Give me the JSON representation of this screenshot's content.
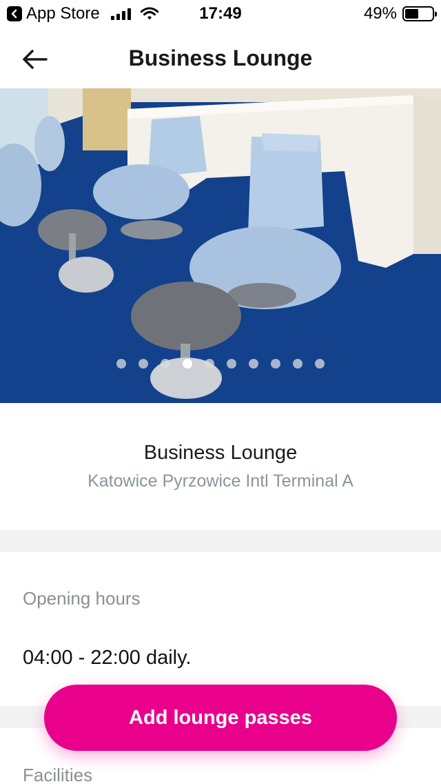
{
  "status_bar": {
    "back_app": "App Store",
    "time": "17:49",
    "battery_percent": "49%",
    "battery_level": 0.49
  },
  "header": {
    "title": "Business Lounge"
  },
  "gallery": {
    "total_images": 10,
    "active_index": 3
  },
  "lounge": {
    "name": "Business Lounge",
    "location": "Katowice Pyrzowice Intl Terminal A"
  },
  "opening_hours": {
    "label": "Opening hours",
    "value": "04:00 - 22:00 daily."
  },
  "facilities": {
    "label": "Facilities"
  },
  "cta": {
    "label": "Add lounge passes",
    "color": "#e9008b"
  },
  "icons": {
    "back": "arrow-left-icon",
    "app_back": "chevron-left-icon",
    "signal": "cellular-signal-icon",
    "wifi": "wifi-icon",
    "battery": "battery-icon"
  }
}
